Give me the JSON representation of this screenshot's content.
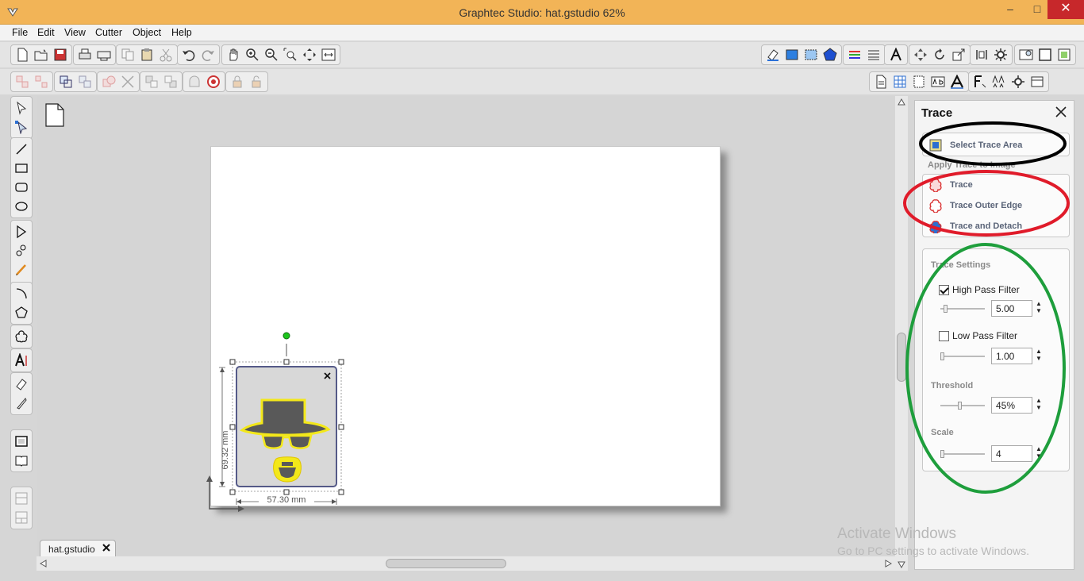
{
  "window": {
    "title": "Graphtec Studio: hat.gstudio 62%",
    "minimize": "–",
    "maximize": "□",
    "close": "✕"
  },
  "menu": [
    "File",
    "Edit",
    "View",
    "Cutter",
    "Object",
    "Help"
  ],
  "document_tab": {
    "label": "hat.gstudio"
  },
  "design": {
    "height_label": "69.32 mm",
    "width_label": "57.30 mm"
  },
  "trace_panel": {
    "title": "Trace",
    "select_trace_area": "Select Trace Area",
    "apply_trace_label": "Apply Trace to Image",
    "actions": [
      "Trace",
      "Trace Outer Edge",
      "Trace and Detach"
    ],
    "settings_label": "Trace Settings",
    "high_pass": {
      "label": "High Pass Filter",
      "checked": true,
      "value": "5.00"
    },
    "low_pass": {
      "label": "Low Pass Filter",
      "checked": false,
      "value": "1.00"
    },
    "threshold": {
      "label": "Threshold",
      "value": "45%"
    },
    "scale": {
      "label": "Scale",
      "value": "4"
    }
  },
  "watermark": {
    "line1": "Activate Windows",
    "line2": "Go to PC settings to activate Windows."
  },
  "colors": {
    "titlebar": "#f2b457",
    "close_button": "#c7282b",
    "annotation_black": "#000000",
    "annotation_red": "#e01b2a",
    "annotation_green": "#1e9e3c",
    "hat_fill": "#595959",
    "outline_yellow": "#f3e81a"
  }
}
